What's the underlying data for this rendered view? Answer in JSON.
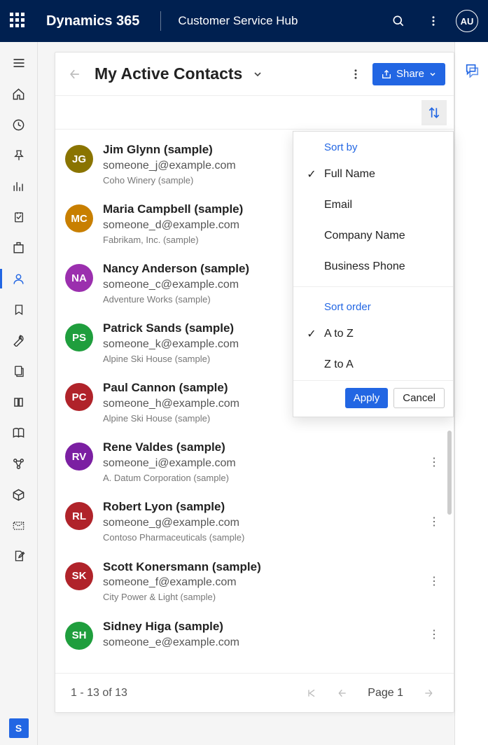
{
  "header": {
    "brand": "Dynamics 365",
    "hub": "Customer Service Hub",
    "user_initials": "AU",
    "s_badge": "S"
  },
  "view": {
    "back": "←",
    "title": "My Active Contacts",
    "share_label": "Share"
  },
  "sort_panel": {
    "sort_by_label": "Sort by",
    "fields": [
      {
        "label": "Full Name",
        "selected": true
      },
      {
        "label": "Email",
        "selected": false
      },
      {
        "label": "Company Name",
        "selected": false
      },
      {
        "label": "Business Phone",
        "selected": false
      }
    ],
    "sort_order_label": "Sort order",
    "orders": [
      {
        "label": "A to Z",
        "selected": true
      },
      {
        "label": "Z to A",
        "selected": false
      }
    ],
    "apply": "Apply",
    "cancel": "Cancel"
  },
  "contacts": [
    {
      "initials": "JG",
      "color": "#8a7400",
      "name": "Jim Glynn (sample)",
      "email": "someone_j@example.com",
      "company": "Coho Winery (sample)"
    },
    {
      "initials": "MC",
      "color": "#c87f00",
      "name": "Maria Campbell (sample)",
      "email": "someone_d@example.com",
      "company": "Fabrikam, Inc. (sample)"
    },
    {
      "initials": "NA",
      "color": "#9b2fae",
      "name": "Nancy Anderson (sample)",
      "email": "someone_c@example.com",
      "company": "Adventure Works (sample)"
    },
    {
      "initials": "PS",
      "color": "#1f9e3d",
      "name": "Patrick Sands (sample)",
      "email": "someone_k@example.com",
      "company": "Alpine Ski House (sample)"
    },
    {
      "initials": "PC",
      "color": "#b0232a",
      "name": "Paul Cannon (sample)",
      "email": "someone_h@example.com",
      "company": "Alpine Ski House (sample)"
    },
    {
      "initials": "RV",
      "color": "#7b1fa2",
      "name": "Rene Valdes (sample)",
      "email": "someone_i@example.com",
      "company": "A. Datum Corporation (sample)"
    },
    {
      "initials": "RL",
      "color": "#b0232a",
      "name": "Robert Lyon (sample)",
      "email": "someone_g@example.com",
      "company": "Contoso Pharmaceuticals (sample)"
    },
    {
      "initials": "SK",
      "color": "#b0232a",
      "name": "Scott Konersmann (sample)",
      "email": "someone_f@example.com",
      "company": "City Power & Light (sample)"
    },
    {
      "initials": "SH",
      "color": "#1f9e3d",
      "name": "Sidney Higa (sample)",
      "email": "someone_e@example.com",
      "company": ""
    }
  ],
  "pager": {
    "range": "1 - 13 of 13",
    "page_label": "Page 1"
  }
}
